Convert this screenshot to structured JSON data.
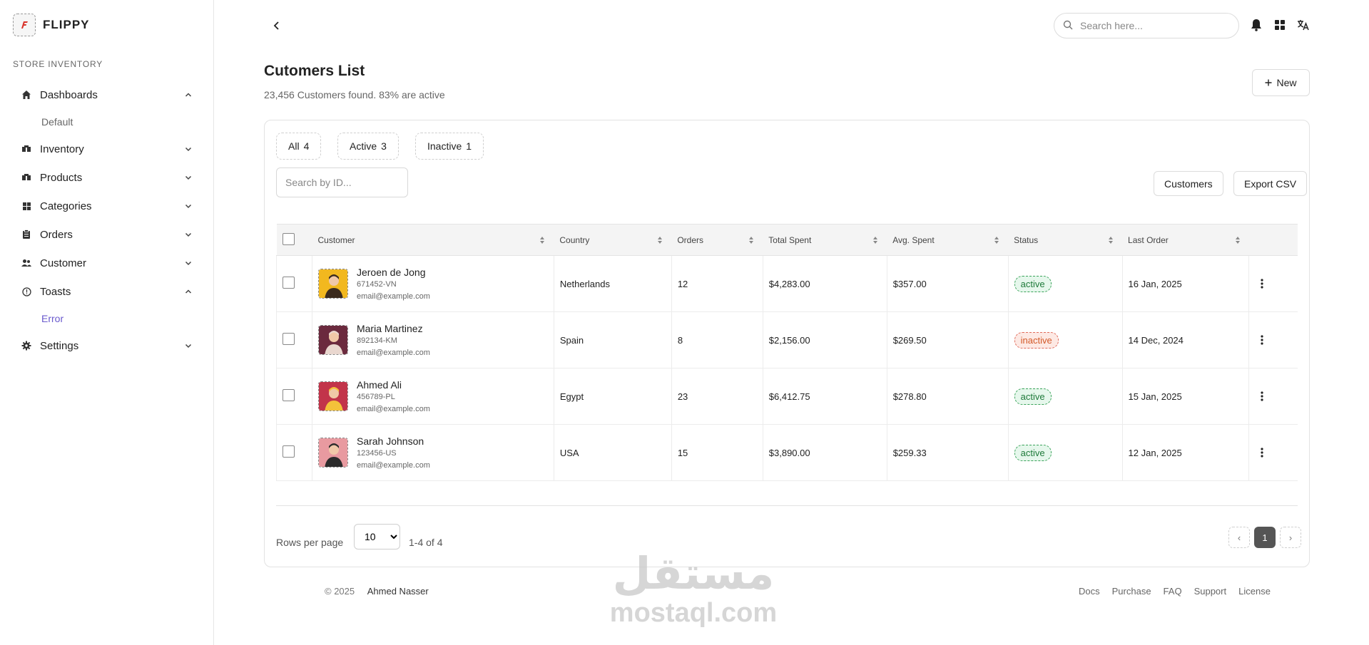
{
  "brand": {
    "name": "FLIPPY"
  },
  "sidebar": {
    "section_title": "STORE INVENTORY",
    "items": [
      {
        "label": "Dashboards",
        "icon": "home-icon",
        "expanded": true,
        "sub": [
          "Default"
        ]
      },
      {
        "label": "Inventory",
        "icon": "boxes-icon",
        "expanded": false
      },
      {
        "label": "Products",
        "icon": "boxes-icon",
        "expanded": false
      },
      {
        "label": "Categories",
        "icon": "grid-icon",
        "expanded": false
      },
      {
        "label": "Orders",
        "icon": "clipboard-icon",
        "expanded": false
      },
      {
        "label": "Customer",
        "icon": "users-icon",
        "expanded": false
      },
      {
        "label": "Toasts",
        "icon": "info-circle-icon",
        "expanded": true,
        "sub": [
          "Error"
        ]
      },
      {
        "label": "Settings",
        "icon": "gear-icon",
        "expanded": false
      }
    ],
    "active_sub": "Error"
  },
  "topbar": {
    "search_placeholder": "Search here..."
  },
  "header": {
    "title": "Cutomers List",
    "subtitle": "23,456 Customers found. 83% are active",
    "new_label": "New"
  },
  "tabs": [
    {
      "label": "All",
      "count": "4"
    },
    {
      "label": "Active",
      "count": "3"
    },
    {
      "label": "Inactive",
      "count": "1"
    }
  ],
  "filters": {
    "id_search_placeholder": "Search by ID...",
    "customers_label": "Customers",
    "export_label": "Export CSV"
  },
  "table": {
    "columns": [
      "Customer",
      "Country",
      "Orders",
      "Total Spent",
      "Avg. Spent",
      "Status",
      "Last Order"
    ],
    "rows": [
      {
        "name": "Jeroen de Jong",
        "id": "671452-VN",
        "email": "email@example.com",
        "country": "Netherlands",
        "orders": "12",
        "total": "$4,283.00",
        "avg": "$357.00",
        "status": "active",
        "last": "16 Jan, 2025",
        "avatar_bg": "#f2b81f",
        "avatar_fg": "#3b2b1e"
      },
      {
        "name": "Maria Martinez",
        "id": "892134-KM",
        "email": "email@example.com",
        "country": "Spain",
        "orders": "8",
        "total": "$2,156.00",
        "avg": "$269.50",
        "status": "inactive",
        "last": "14 Dec, 2024",
        "avatar_bg": "#6b2a3e",
        "avatar_fg": "#e9d7cf"
      },
      {
        "name": "Ahmed Ali",
        "id": "456789-PL",
        "email": "email@example.com",
        "country": "Egypt",
        "orders": "23",
        "total": "$6,412.75",
        "avg": "$278.80",
        "status": "active",
        "last": "15 Jan, 2025",
        "avatar_bg": "#c2344a",
        "avatar_fg": "#f4c23a"
      },
      {
        "name": "Sarah Johnson",
        "id": "123456-US",
        "email": "email@example.com",
        "country": "USA",
        "orders": "15",
        "total": "$3,890.00",
        "avg": "$259.33",
        "status": "active",
        "last": "12 Jan, 2025",
        "avatar_bg": "#e89aa0",
        "avatar_fg": "#2b2b2b"
      }
    ]
  },
  "pagination": {
    "rows_per_page_label": "Rows per page",
    "rows_per_page_value": "10",
    "range": "1-4 of 4",
    "current_page": "1",
    "prev": "‹",
    "next": "›"
  },
  "footer": {
    "copyright": "© 2025",
    "author": "Ahmed Nasser",
    "links": [
      "Docs",
      "Purchase",
      "FAQ",
      "Support",
      "License"
    ]
  },
  "watermark": {
    "arabic": "مستقل",
    "latin": "mostaql.com"
  },
  "colors": {
    "accent": "#6a5acd",
    "active_bg": "#e6f7ec",
    "inactive_bg": "#fde9e4",
    "page_current": "#555555"
  }
}
